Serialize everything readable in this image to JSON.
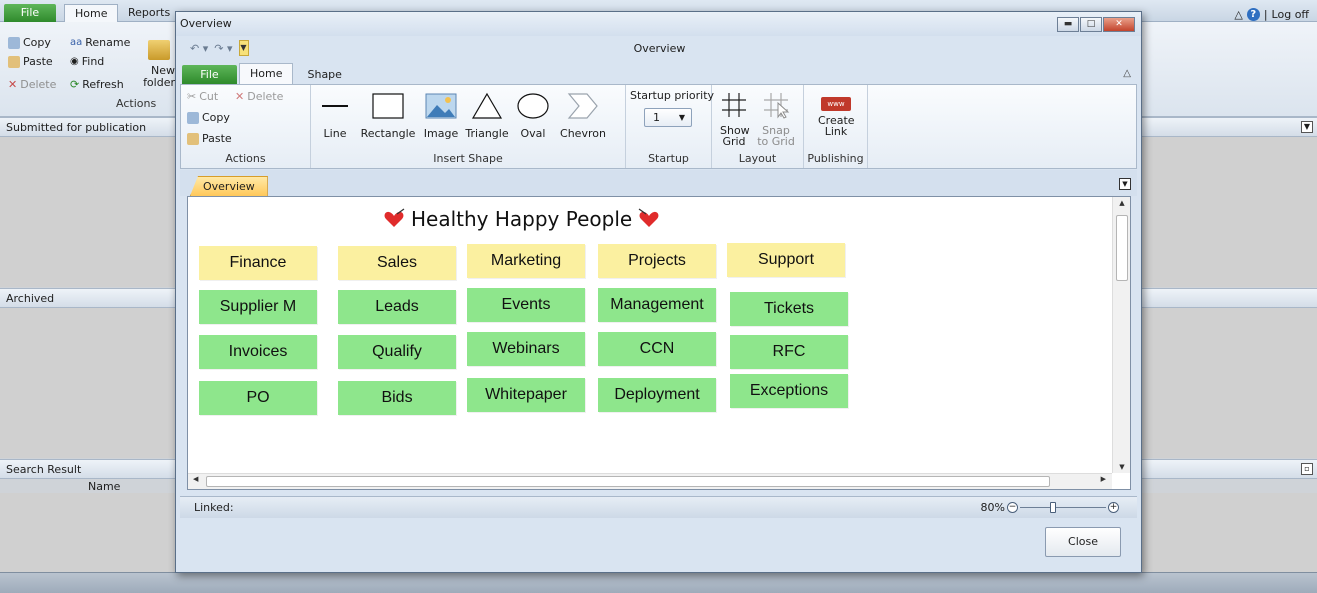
{
  "app": {
    "tabs": {
      "file": "File",
      "home": "Home",
      "reports": "Reports"
    },
    "log_off": "Log off",
    "help_glyph": "?",
    "commands": {
      "copy": "Copy",
      "rename": "Rename",
      "paste": "Paste",
      "find": "Find",
      "delete": "Delete",
      "refresh": "Refresh",
      "new_folder": "New folder"
    },
    "group_label": "Actions",
    "panels": {
      "submitted": "Submitted for publication",
      "archived": "Archived",
      "search": "Search Result",
      "search_col_name": "Name"
    }
  },
  "window": {
    "title": "Overview",
    "ribbon_title": "Overview",
    "tabs": {
      "file": "File",
      "home": "Home",
      "shape": "Shape"
    },
    "actions": {
      "cut": "Cut",
      "delete": "Delete",
      "copy": "Copy",
      "paste": "Paste",
      "group": "Actions"
    },
    "insert_shape": {
      "line": "Line",
      "rectangle": "Rectangle",
      "image": "Image",
      "triangle": "Triangle",
      "oval": "Oval",
      "chevron": "Chevron",
      "group": "Insert Shape"
    },
    "startup": {
      "label": "Startup priority",
      "value": "1",
      "group": "Startup"
    },
    "layout": {
      "show_grid": "Show Grid",
      "snap_to_grid": "Snap to Grid",
      "group": "Layout"
    },
    "publishing": {
      "create_link": "Create Link",
      "group": "Publishing",
      "link_badge": "www"
    },
    "document_tab": "Overview",
    "canvas": {
      "title": "Healthy Happy People",
      "columns": [
        {
          "header": "Finance",
          "items": [
            "Supplier M",
            "Invoices",
            "PO"
          ]
        },
        {
          "header": "Sales",
          "items": [
            "Leads",
            "Qualify",
            "Bids"
          ]
        },
        {
          "header": "Marketing",
          "items": [
            "Events",
            "Webinars",
            "Whitepaper"
          ]
        },
        {
          "header": "Projects",
          "items": [
            "Management",
            "CCN",
            "Deployment"
          ]
        },
        {
          "header": "Support",
          "items": [
            "Tickets",
            "RFC",
            "Exceptions"
          ]
        }
      ]
    },
    "status": {
      "linked": "Linked:",
      "zoom": "80%"
    },
    "close_button": "Close"
  },
  "colors": {
    "header_note": "#fbf0a0",
    "item_note": "#8ee68c",
    "file_tab": "#3a963a",
    "doc_tab": "#ffc85a"
  }
}
